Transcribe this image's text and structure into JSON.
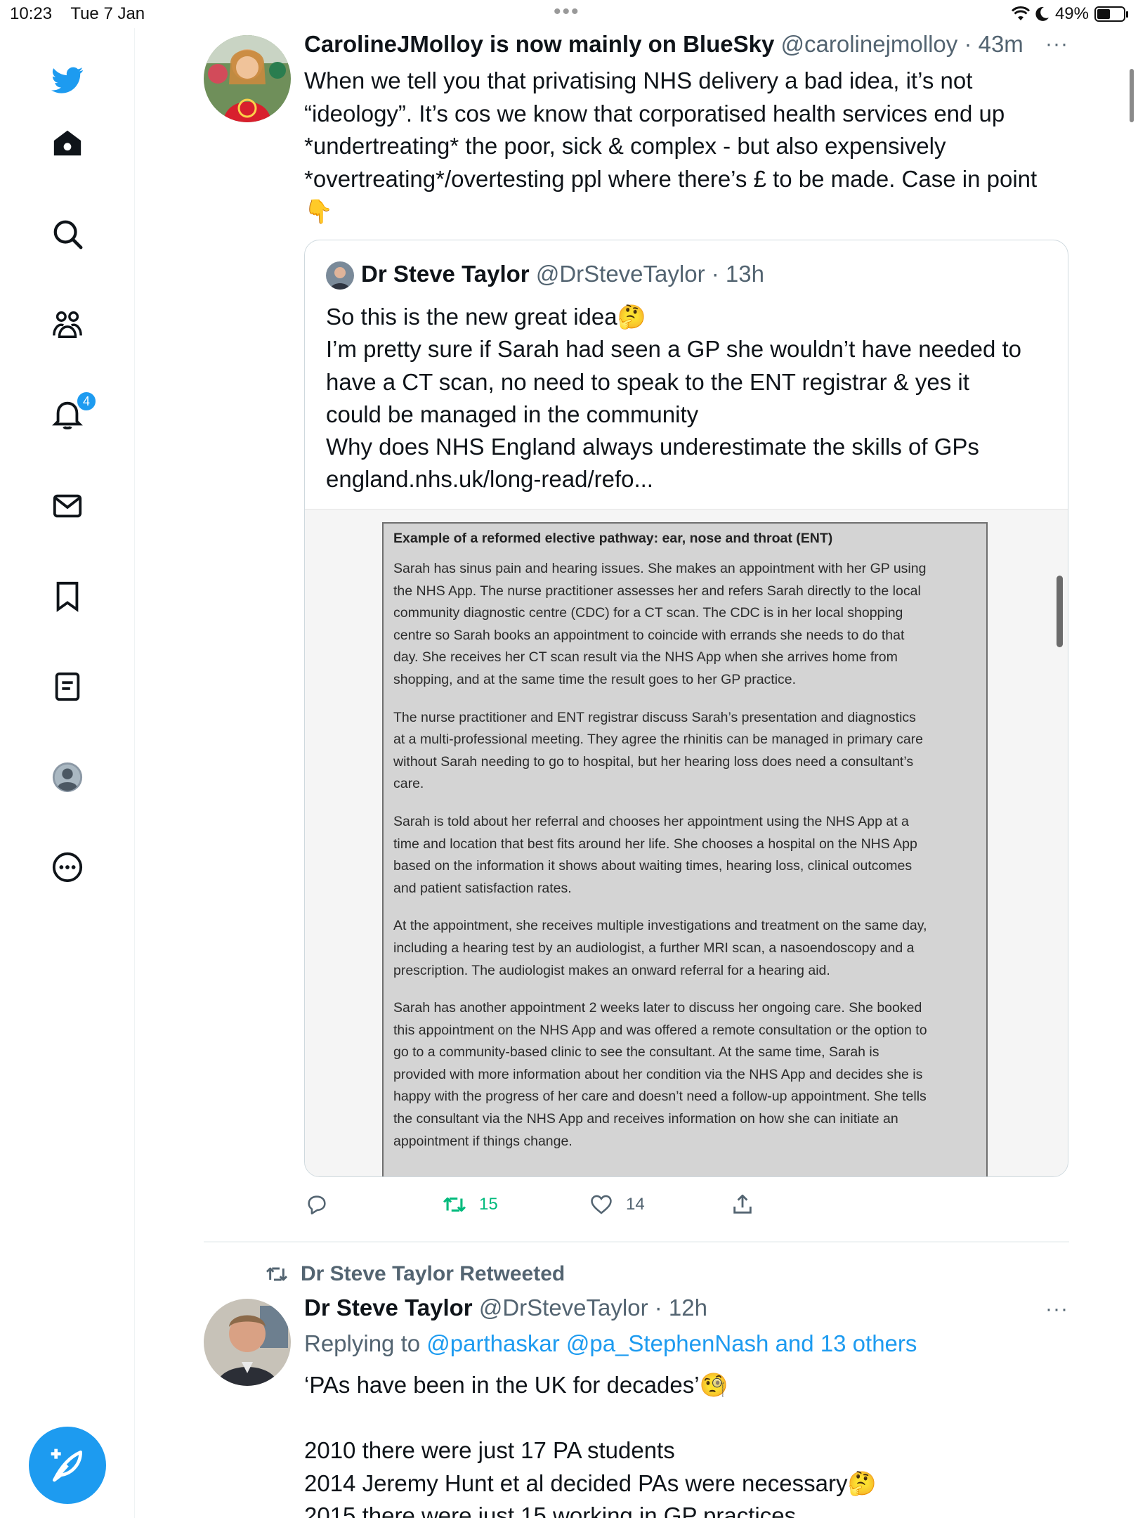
{
  "status_bar": {
    "time": "10:23",
    "date": "Tue 7 Jan",
    "battery": "49%",
    "battery_level": 0.49
  },
  "sidebar": {
    "notification_count": "4",
    "items": [
      {
        "icon": "twitter-bird-icon"
      },
      {
        "icon": "home-icon"
      },
      {
        "icon": "search-icon"
      },
      {
        "icon": "communities-icon"
      },
      {
        "icon": "bell-icon"
      },
      {
        "icon": "mail-icon"
      },
      {
        "icon": "bookmark-icon"
      },
      {
        "icon": "lists-icon"
      },
      {
        "icon": "profile-icon"
      },
      {
        "icon": "more-icon"
      }
    ],
    "compose_icon": "compose-feather-icon"
  },
  "tweet1": {
    "name": "CarolineJMolloy is now mainly on BlueSky",
    "handle": "@carolinejmolloy",
    "time": "· 43m",
    "lines": [
      "When we tell you that privatising NHS delivery a bad idea, it’s not",
      "“ideology”. It’s cos we know that corporatised health services end up",
      "*undertreating* the poor, sick & complex - but also expensively",
      "*overtreating*/overtesting ppl where there’s £ to be made. Case in point",
      "👇"
    ],
    "quote": {
      "name": "Dr Steve Taylor",
      "handle": "@DrSteveTaylor",
      "time": "· 13h",
      "lines": [
        "So this is the new great idea🤔",
        "I’m pretty sure if Sarah had seen a GP she wouldn’t have needed to",
        "have a CT scan, no need to speak to the ENT registrar & yes it",
        "could be managed in the community",
        "Why does NHS England always underestimate the skills of GPs",
        "england.nhs.uk/long-read/refo..."
      ],
      "document": {
        "title": "Example of a reformed elective pathway: ear, nose and throat (ENT)",
        "paragraphs": [
          [
            "Sarah has sinus pain and hearing issues. She makes an appointment with her GP using",
            "the NHS App. The nurse practitioner assesses her and refers Sarah directly to the local",
            "community diagnostic centre (CDC) for a CT scan. The CDC is in her local shopping",
            "centre so Sarah books an appointment to coincide with errands she needs to do that",
            "day. She receives her CT scan result via the NHS App when she arrives home from",
            "shopping, and at the same time the result goes to her GP practice."
          ],
          [
            "The nurse practitioner and ENT registrar discuss Sarah’s presentation and diagnostics",
            "at a multi-professional meeting. They agree the rhinitis can be managed in primary care",
            "without Sarah needing to go to hospital, but her hearing loss does need a consultant’s",
            "care."
          ],
          [
            "Sarah is told about her referral and chooses her appointment using the NHS App at a",
            "time and location that best fits around her life. She chooses a hospital on the NHS App",
            "based on the information it shows about waiting times, hearing loss, clinical outcomes",
            "and patient satisfaction rates."
          ],
          [
            "At the appointment, she receives multiple investigations and treatment on the same day,",
            "including a hearing test by an audiologist, a further MRI scan, a nasoendoscopy and a",
            "prescription. The audiologist makes an onward referral for a hearing aid."
          ],
          [
            "Sarah has another appointment 2 weeks later to discuss her ongoing care. She booked",
            "this appointment on the NHS App and was offered a remote consultation or the option to",
            "go to a community-based clinic to see the consultant. At the same time, Sarah is",
            "provided with more information about her condition via the NHS App and decides she is",
            "happy with the progress of her care and doesn’t need a follow-up appointment. She tells",
            "the consultant via the NHS App and receives information on how she can initiate an",
            "appointment if things change."
          ]
        ]
      }
    },
    "actions": {
      "retweets": "15",
      "likes": "14"
    }
  },
  "tweet2": {
    "retweeted_by": "Dr Steve Taylor Retweeted",
    "name": "Dr Steve Taylor",
    "handle": "@DrSteveTaylor",
    "time": "· 12h",
    "replying_prefix": "Replying to",
    "replying_to": "@parthaskar @pa_StephenNash and 13 others",
    "lines": [
      "‘PAs have been in the UK for decades’🧐",
      "",
      "2010 there were just 17 PA students",
      "2014 Jeremy Hunt et al decided PAs were necessary🤔",
      "2015 there were just 15 working in GP practices"
    ]
  },
  "colors": {
    "accent": "#1d9bf0",
    "retweet_green": "#00ba7c",
    "text": "#0f1419",
    "muted": "#536471"
  }
}
